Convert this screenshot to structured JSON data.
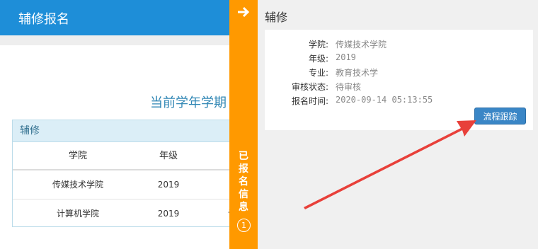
{
  "header": {
    "title": "辅修报名"
  },
  "banner": {
    "text": "当前学年学期"
  },
  "table": {
    "panel_title": "辅修",
    "columns": [
      "学院",
      "年级",
      ""
    ],
    "rows": [
      [
        "传媒技术学院",
        "2019",
        ""
      ],
      [
        "计算机学院",
        "2019",
        "计"
      ]
    ]
  },
  "tab": {
    "label_chars": [
      "已",
      "报",
      "名",
      "信",
      "息"
    ],
    "count": "1"
  },
  "detail": {
    "title": "辅修",
    "fields": [
      {
        "label": "学院:",
        "value": "传媒技术学院"
      },
      {
        "label": "年级:",
        "value": "2019"
      },
      {
        "label": "专业:",
        "value": "教育技术学"
      },
      {
        "label": "审核状态:",
        "value": "待审核"
      },
      {
        "label": "报名时间:",
        "value": "2020-09-14 05:13:55"
      }
    ],
    "button": "流程跟踪"
  },
  "colors": {
    "header": "#1e8ed8",
    "tab": "#ff9900",
    "button": "#3a86c6",
    "annotation": "#e8403a"
  }
}
